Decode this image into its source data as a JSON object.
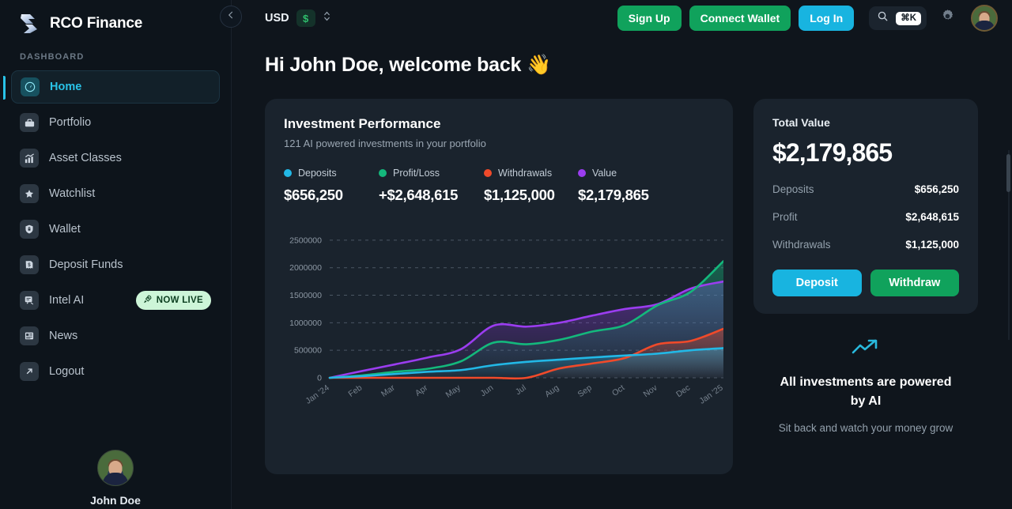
{
  "brand": {
    "name": "RCO Finance",
    "logo_icon": "rco-logo-icon"
  },
  "sidebar": {
    "section_label": "DASHBOARD",
    "items": [
      {
        "label": "Home",
        "icon": "speedometer-icon",
        "active": true
      },
      {
        "label": "Portfolio",
        "icon": "briefcase-icon",
        "active": false
      },
      {
        "label": "Asset Classes",
        "icon": "bar-chart-trend-icon",
        "active": false
      },
      {
        "label": "Watchlist",
        "icon": "star-icon",
        "active": false
      },
      {
        "label": "Wallet",
        "icon": "wallet-lock-icon",
        "active": false
      },
      {
        "label": "Deposit Funds",
        "icon": "dollar-receipt-icon",
        "active": false
      },
      {
        "label": "Intel AI",
        "icon": "chat-ai-icon",
        "active": false,
        "badge": "NOW LIVE",
        "badge_icon": "rocket-icon"
      },
      {
        "label": "News",
        "icon": "news-icon",
        "active": false
      },
      {
        "label": "Logout",
        "icon": "arrow-out-icon",
        "active": false
      }
    ],
    "profile_name": "John Doe",
    "collapse_icon": "chevron-left-icon"
  },
  "topbar": {
    "currency_code": "USD",
    "currency_symbol": "$",
    "currency_caret_icon": "chevron-updown-icon",
    "sign_up": "Sign Up",
    "connect_wallet": "Connect Wallet",
    "log_in": "Log In",
    "search_icon": "search-icon",
    "search_shortcut": "⌘K",
    "settings_icon": "gear-icon",
    "avatar_icon": "avatar"
  },
  "greeting": "Hi John Doe, welcome back 👋",
  "chart_card": {
    "title": "Investment Performance",
    "subtitle": "121 AI powered investments in your portfolio",
    "legend": [
      {
        "name": "Deposits",
        "value": "$656,250",
        "color": "#22b8e6"
      },
      {
        "name": "Profit/Loss",
        "value": "+$2,648,615",
        "color": "#14b87c"
      },
      {
        "name": "Withdrawals",
        "value": "$1,125,000",
        "color": "#f04a2a"
      },
      {
        "name": "Value",
        "value": "$2,179,865",
        "color": "#9b3df0"
      }
    ]
  },
  "chart_data": {
    "type": "line",
    "title": "Investment Performance",
    "xlabel": "",
    "ylabel": "",
    "grid": true,
    "legend_position": "top",
    "ylim": [
      0,
      2700000
    ],
    "yticks": [
      0,
      500000,
      1000000,
      1500000,
      2000000,
      2500000
    ],
    "ytick_labels": [
      "0",
      "500000",
      "1000000",
      "1500000",
      "2000000",
      "2500000"
    ],
    "categories": [
      "Jan '24",
      "Feb",
      "Mar",
      "Apr",
      "May",
      "Jun",
      "Jul",
      "Aug",
      "Sep",
      "Oct",
      "Nov",
      "Dec",
      "Jan '25"
    ],
    "series": [
      {
        "name": "Deposits",
        "color": "#22b8e6",
        "values": [
          0,
          30000,
          70000,
          110000,
          140000,
          230000,
          290000,
          330000,
          370000,
          405000,
          440000,
          500000,
          540000
        ]
      },
      {
        "name": "Profit/Loss",
        "color": "#14b87c",
        "values": [
          0,
          45000,
          110000,
          165000,
          300000,
          640000,
          610000,
          690000,
          840000,
          960000,
          1320000,
          1560000,
          2120000
        ]
      },
      {
        "name": "Withdrawals",
        "color": "#f04a2a",
        "values": [
          0,
          0,
          0,
          0,
          0,
          0,
          0,
          170000,
          260000,
          360000,
          610000,
          670000,
          890000
        ]
      },
      {
        "name": "Value",
        "color": "#9b3df0",
        "values": [
          0,
          125000,
          245000,
          370000,
          520000,
          950000,
          930000,
          1000000,
          1130000,
          1250000,
          1340000,
          1620000,
          1750000
        ]
      }
    ]
  },
  "total_card": {
    "label": "Total Value",
    "value": "$2,179,865",
    "stats": [
      {
        "label": "Deposits",
        "value": "$656,250"
      },
      {
        "label": "Profit",
        "value": "$2,648,615"
      },
      {
        "label": "Withdrawals",
        "value": "$1,125,000"
      }
    ],
    "deposit_button": "Deposit",
    "withdraw_button": "Withdraw"
  },
  "ai_box": {
    "icon": "trend-up-icon",
    "title": "All investments are powered by AI",
    "subtitle": "Sit back and watch your money grow"
  },
  "colors": {
    "accent_cyan": "#18b4e0",
    "accent_green": "#10a25c",
    "page_bg": "#0f151c",
    "sidebar_bg": "#0d141b",
    "card_bg": "#1a232d"
  }
}
